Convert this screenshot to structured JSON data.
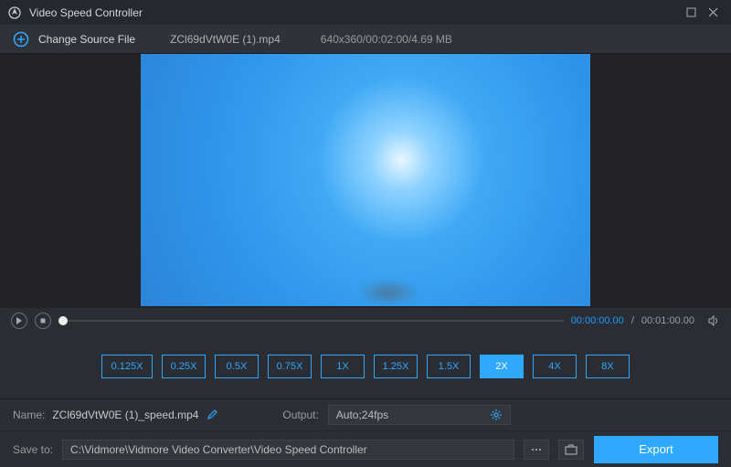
{
  "titlebar": {
    "title": "Video Speed Controller"
  },
  "sourcebar": {
    "change_label": "Change Source File",
    "filename": "ZCl69dVtW0E (1).mp4",
    "info": "640x360/00:02:00/4.69 MB"
  },
  "playback": {
    "current_time": "00:00:00.00",
    "total_time": "00:01:00.00"
  },
  "speeds": {
    "s0125": "0.125X",
    "s025": "0.25X",
    "s05": "0.5X",
    "s075": "0.75X",
    "s1": "1X",
    "s125": "1.25X",
    "s15": "1.5X",
    "s2": "2X",
    "s4": "4X",
    "s8": "8X",
    "active": "s2"
  },
  "meta": {
    "name_label": "Name:",
    "name_value": "ZCl69dVtW0E (1)_speed.mp4",
    "output_label": "Output:",
    "output_value": "Auto;24fps"
  },
  "save": {
    "label": "Save to:",
    "path": "C:\\Vidmore\\Vidmore Video Converter\\Video Speed Controller"
  },
  "export_label": "Export"
}
